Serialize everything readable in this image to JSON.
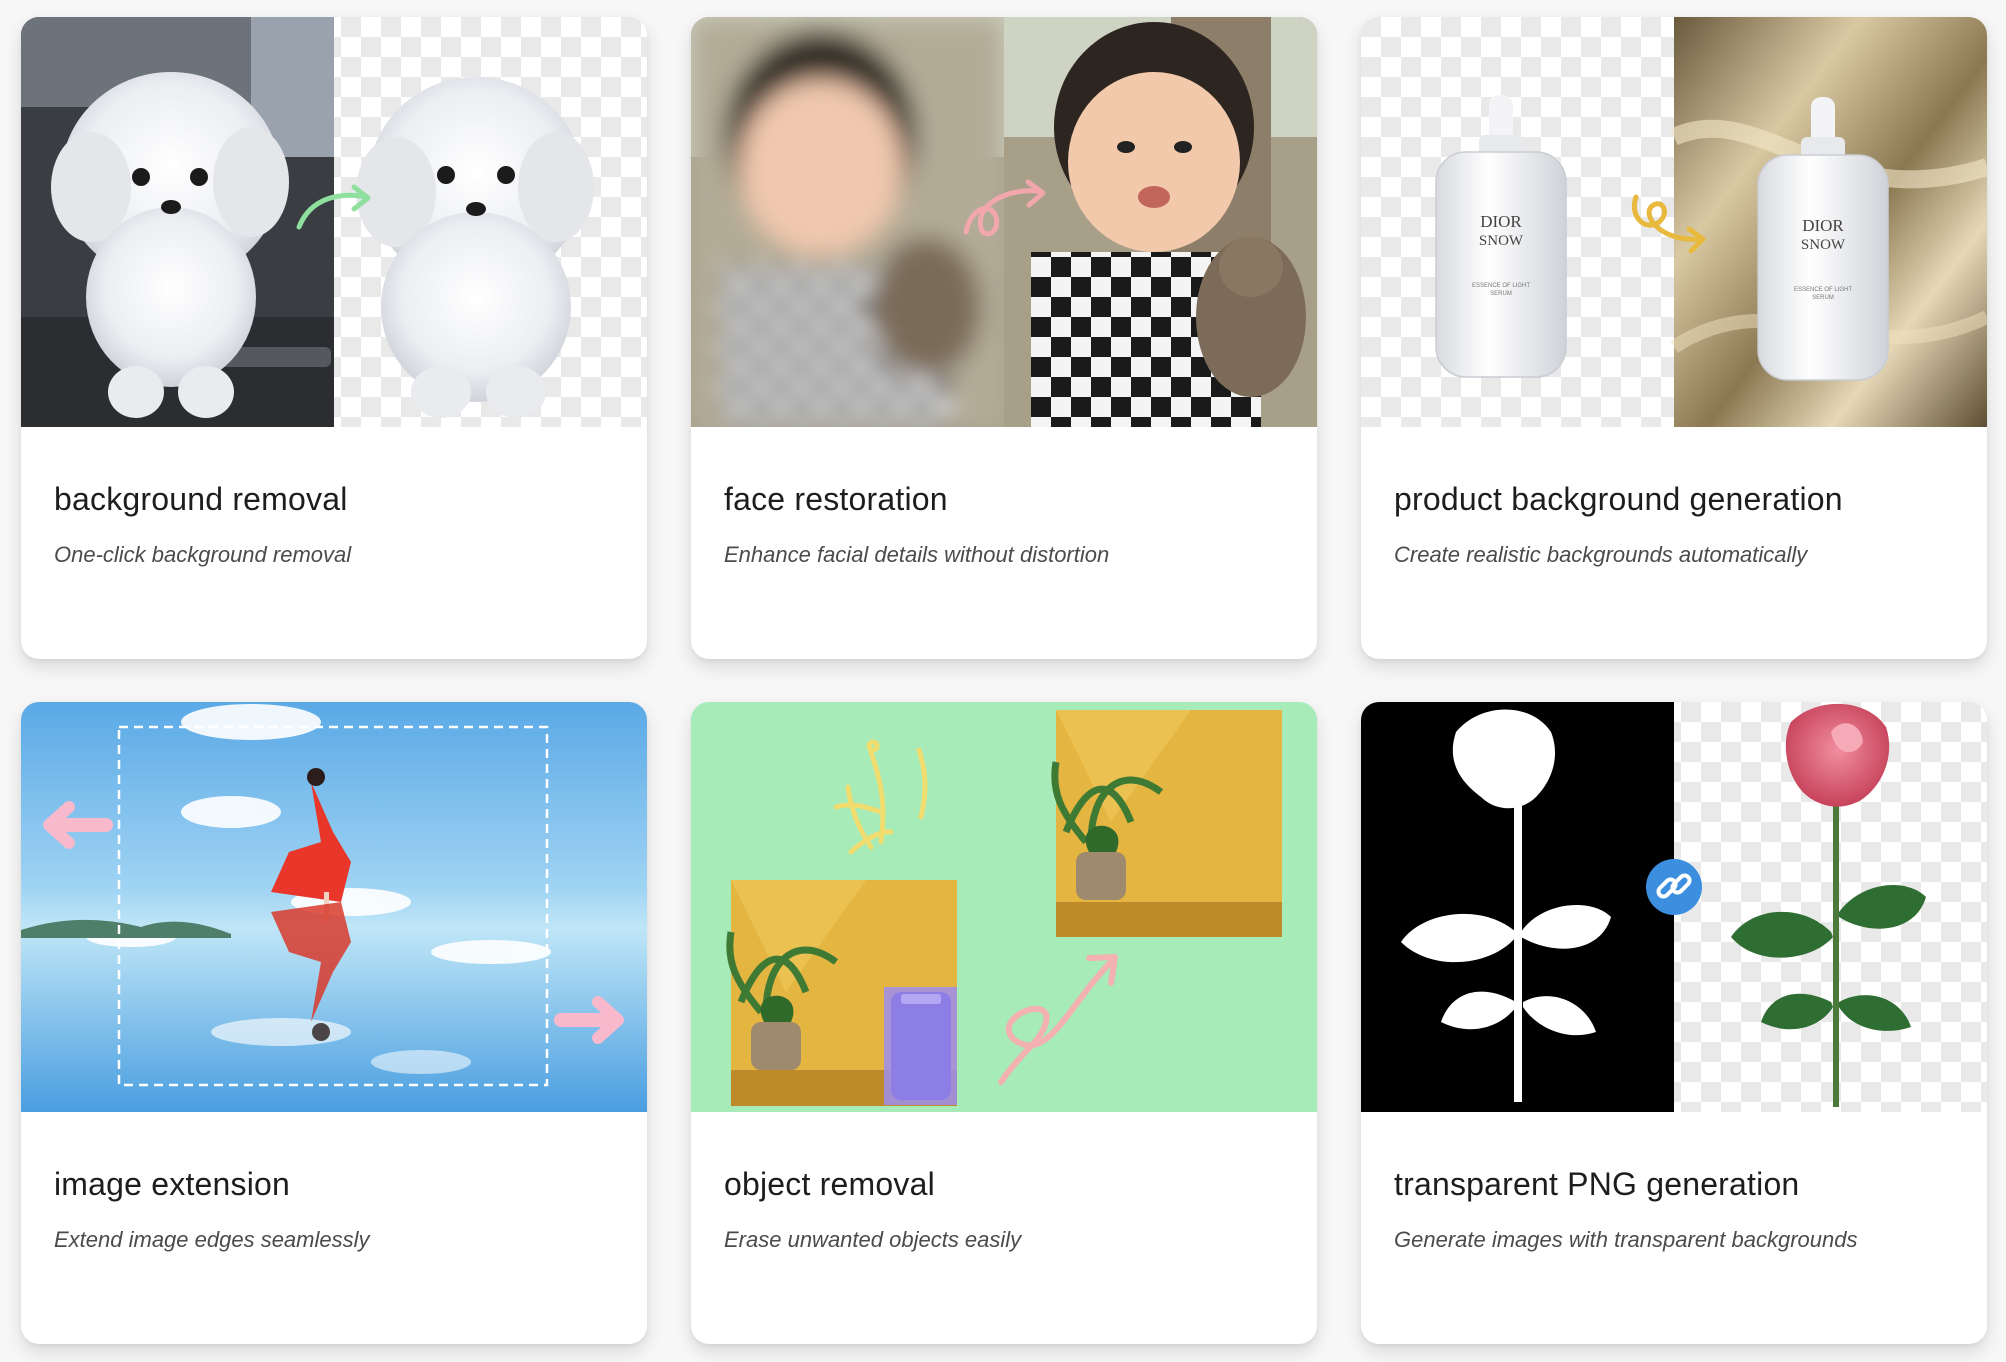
{
  "cards": [
    {
      "title": "background removal",
      "description": "One-click background removal",
      "arrow_color": "#8fdf9f"
    },
    {
      "title": "face restoration",
      "description": "Enhance facial details without distortion",
      "arrow_color": "#f2a7ad"
    },
    {
      "title": "product background generation",
      "description": "Create realistic backgrounds automatically",
      "arrow_color": "#e8b93c",
      "bottle_label": [
        "DIOR",
        "SNOW",
        "ESSENCE OF LIGHT",
        "SERUM"
      ]
    },
    {
      "title": "image extension",
      "description": "Extend image edges seamlessly",
      "arrow_color": "#f8b9cc"
    },
    {
      "title": "object removal",
      "description": "Erase unwanted objects easily",
      "arrow_color": "#f3b1b1",
      "background_color": "#a6ebb8"
    },
    {
      "title": "transparent PNG generation",
      "description": "Generate images with transparent backgrounds",
      "link_badge_color": "#3c8fde"
    }
  ]
}
